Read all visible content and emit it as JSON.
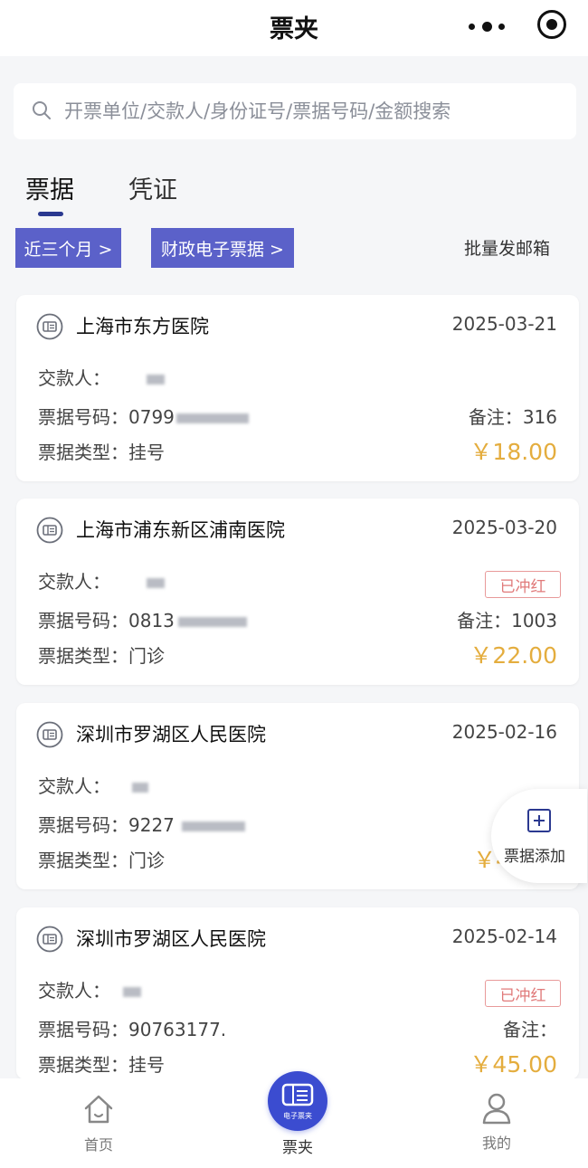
{
  "header": {
    "title": "票夹",
    "more_icon": "more-dots-icon",
    "target_icon": "target-icon"
  },
  "search": {
    "placeholder": "开票单位/交款人/身份证号/票据号码/金额搜索"
  },
  "tabs": [
    {
      "label": "票据",
      "active": true
    },
    {
      "label": "凭证",
      "active": false
    }
  ],
  "filters": {
    "period": "近三个月 >",
    "type": "财政电子票据 >",
    "batch_email": "批量发邮箱"
  },
  "labels": {
    "payer": "交款人：",
    "bill_no": "票据号码：",
    "bill_type": "票据类型：",
    "note": "备注："
  },
  "bills": [
    {
      "hospital": "上海市东方医院",
      "date": "2025-03-21",
      "bill_no_prefix": "0799",
      "bill_type": "挂号",
      "stamp": "",
      "note": "316",
      "amount": "￥18.00"
    },
    {
      "hospital": "上海市浦东新区浦南医院",
      "date": "2025-03-20",
      "bill_no_prefix": "0813",
      "bill_type": "门诊",
      "stamp": "已冲红",
      "note": "1003",
      "amount": "￥22.00"
    },
    {
      "hospital": "深圳市罗湖区人民医院",
      "date": "2025-02-16",
      "bill_no_prefix": "9227",
      "bill_type": "门诊",
      "stamp": "",
      "note": "",
      "amount": "￥4."
    },
    {
      "hospital": "深圳市罗湖区人民医院",
      "date": "2025-02-14",
      "bill_no_prefix": "90763177.",
      "bill_type": "挂号",
      "stamp": "已冲红",
      "note": "",
      "amount": "￥45.00"
    }
  ],
  "fab": {
    "label": "票据添加"
  },
  "bottom_nav": {
    "home": "首页",
    "wallet": "票夹",
    "wallet_badge": "电子票夹",
    "mine": "我的"
  },
  "colors": {
    "primary": "#3b4cd0",
    "chip": "#5b61c9",
    "amount": "#e4ad3e",
    "stamp": "#e07a7a"
  }
}
